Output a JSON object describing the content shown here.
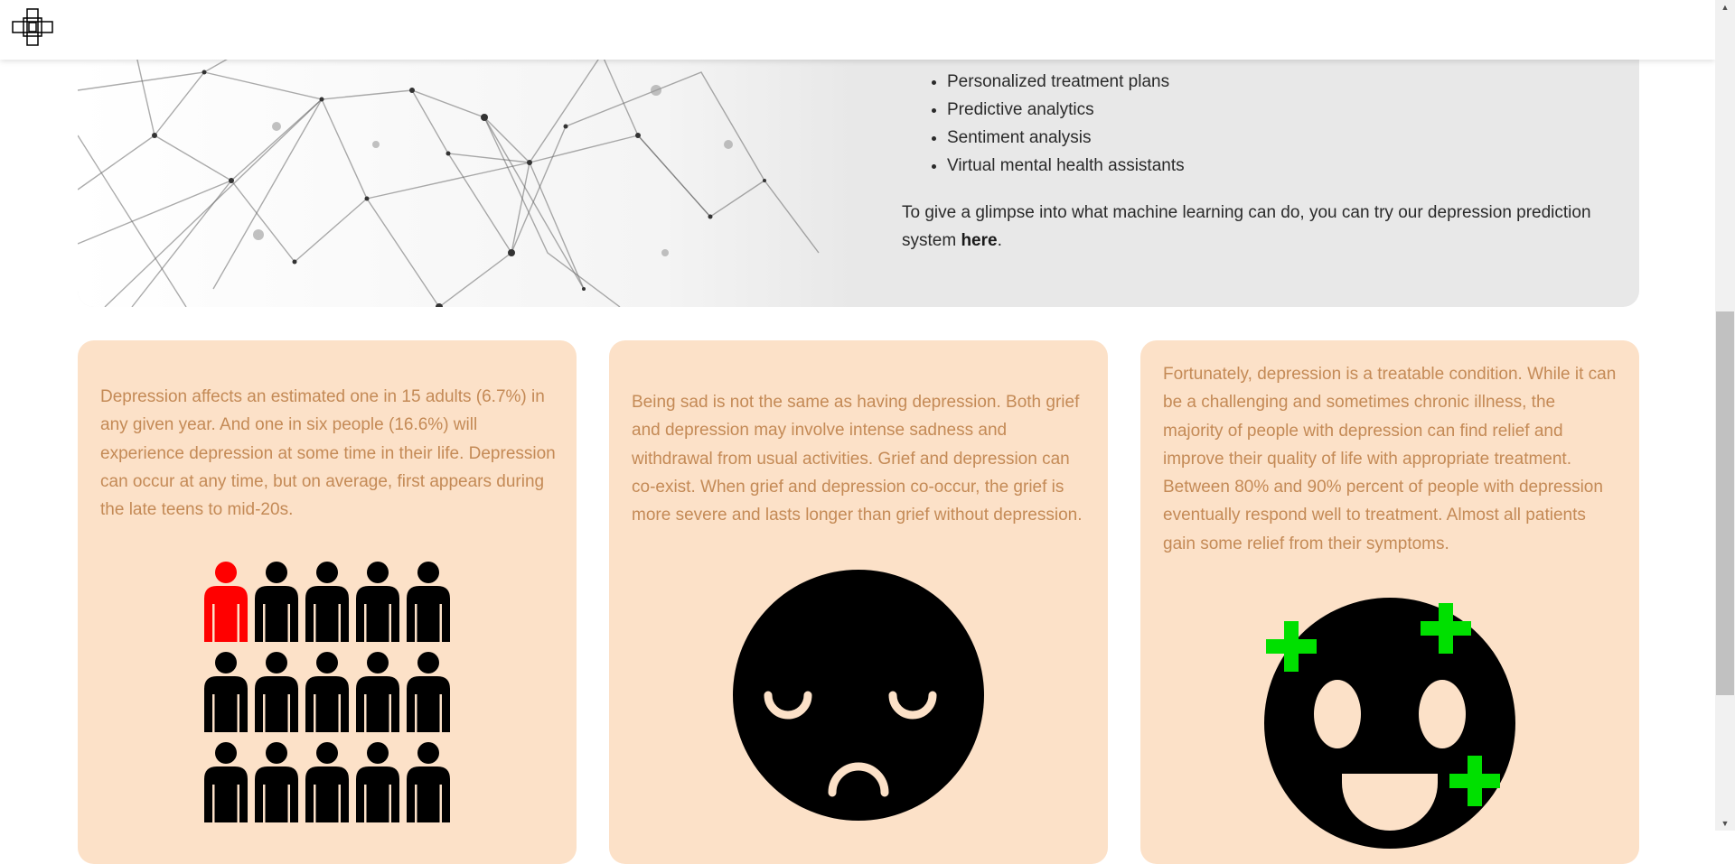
{
  "hero": {
    "list_items": [
      "Personalized treatment plans",
      "Predictive analytics",
      "Sentiment analysis",
      "Virtual mental health assistants"
    ],
    "paragraph_prefix": "To give a glimpse into what machine learning can do, you can try our depression prediction system ",
    "link_text": "here",
    "paragraph_suffix": "."
  },
  "cards": [
    {
      "text": "Depression affects an estimated one in 15 adults (6.7%) in any given year. And one in six people (16.6%) will experience depression at some time in their life. Depression can occur at any time, but on average, first appears during the late teens to mid-20s.",
      "icon": "people-grid-icon"
    },
    {
      "text": "Being sad is not the same as having depression. Both grief and depression may involve intense sadness and withdrawal from usual activities. Grief and depression can co-exist. When grief and depression co-occur, the grief is more severe and lasts longer than grief without depression.",
      "icon": "sad-face-icon"
    },
    {
      "text": "Fortunately, depression is a treatable condition. While it can be a challenging and sometimes chronic illness, the majority of people with depression can find relief and improve their quality of life with appropriate treatment. Between 80% and 90% percent of people with depression eventually respond well to treatment. Almost all patients gain some relief from their symptoms.",
      "icon": "happy-face-icon"
    }
  ],
  "colors": {
    "card_bg": "#fce1c8",
    "card_text": "#c48a56",
    "highlight_person": "#ff0000",
    "plus_sign": "#00e000",
    "hero_bg": "#e8e8e8"
  },
  "scrollbar": {
    "up_arrow": "▲",
    "down_arrow": "▼"
  }
}
